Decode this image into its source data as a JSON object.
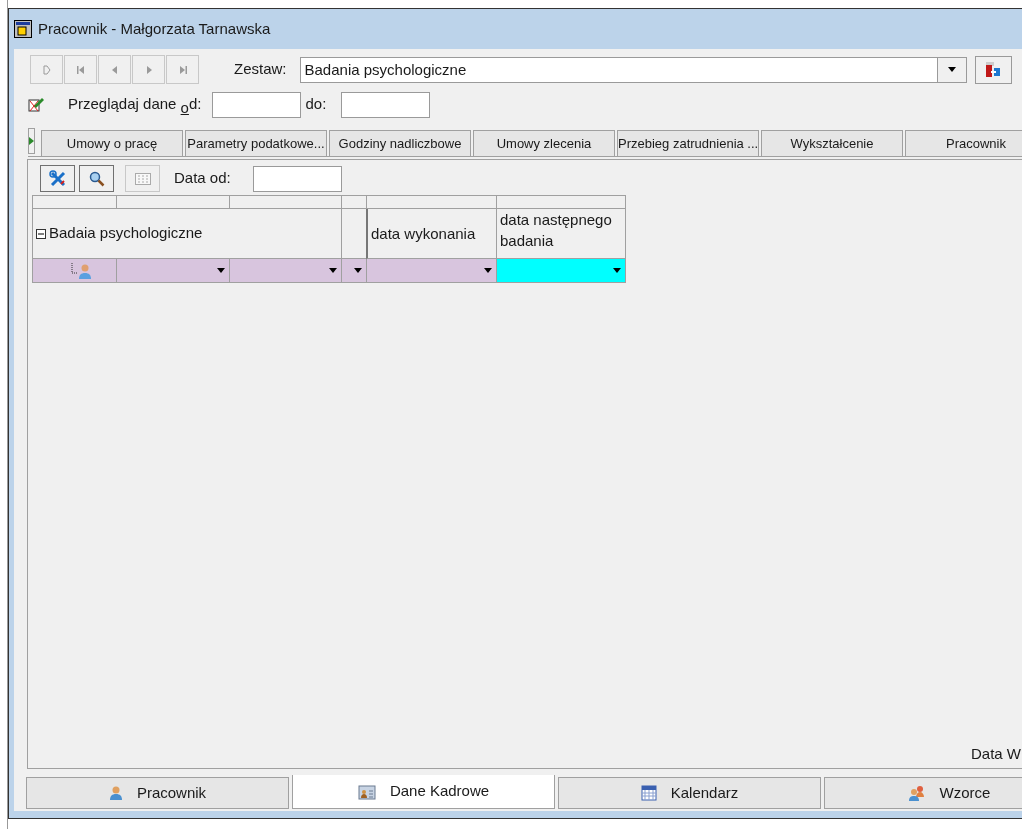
{
  "window": {
    "title": "Pracownik - Małgorzata Tarnawska"
  },
  "nav_buttons": [
    {
      "kind": "new",
      "disabled": true
    },
    {
      "kind": "first",
      "disabled": true
    },
    {
      "kind": "prev",
      "disabled": true
    },
    {
      "kind": "next",
      "disabled": true
    },
    {
      "kind": "last",
      "disabled": true
    }
  ],
  "set": {
    "label": "Zestaw:",
    "value": "Badania psychologiczne"
  },
  "browse": {
    "label": "Przeglądaj dane $_{o}$d:",
    "to_label": "do:"
  },
  "tabs": [
    {
      "label": "Umowy o pracę",
      "selected": false
    },
    {
      "label": "Parametry podatkowe...",
      "selected": false
    },
    {
      "label": "Godziny nadliczbowe",
      "selected": false
    },
    {
      "label": "Umowy zlecenia",
      "selected": false
    },
    {
      "label": "Przebieg zatrudnienia ...",
      "selected": false
    },
    {
      "label": "Wykształcenie",
      "selected": false
    },
    {
      "label": "Pracownik",
      "selected": false
    }
  ],
  "toolbar": {
    "date_label": "Data od:"
  },
  "grid": {
    "group": "Badaia psychologiczne",
    "columns": [
      "data wykonania",
      "data następnego badania"
    ],
    "row": [
      {
        "kind": "icon",
        "selected": false
      },
      {
        "kind": "dropdown",
        "selected": false
      },
      {
        "kind": "dropdown",
        "selected": false
      },
      {
        "kind": "dropdown",
        "selected": false
      },
      {
        "kind": "dropdown",
        "selected": false
      },
      {
        "kind": "dropdown",
        "selected": true
      }
    ]
  },
  "panel_footer": "Data W",
  "bottom_tabs": [
    {
      "label": "Pracownik",
      "kind": "person",
      "selected": false
    },
    {
      "label": "Dane Kadrowe",
      "kind": "card",
      "selected": true
    },
    {
      "label": "Kalendarz",
      "kind": "calendar",
      "selected": false
    },
    {
      "label": "Wzorce",
      "kind": "people",
      "selected": false
    }
  ]
}
